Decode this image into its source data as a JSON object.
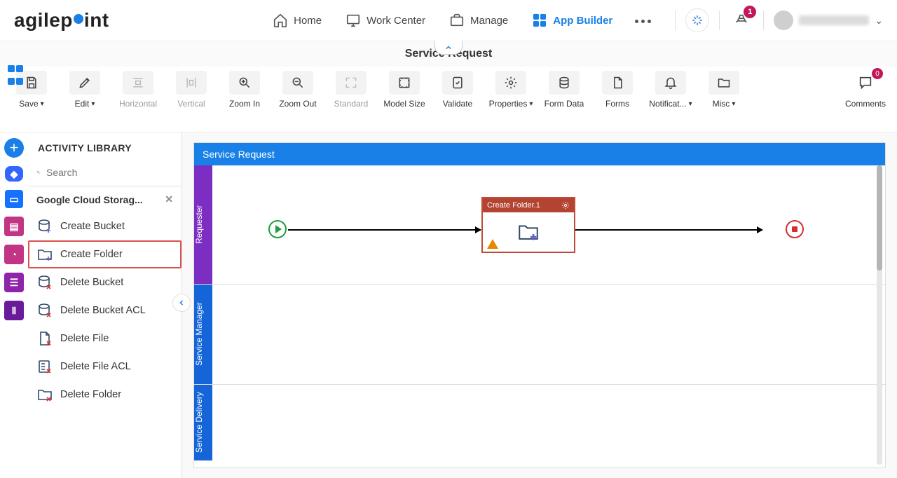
{
  "brand": {
    "text_before": "agilep",
    "text_after": "int"
  },
  "nav": {
    "items": [
      {
        "label": "Home"
      },
      {
        "label": "Work Center"
      },
      {
        "label": "Manage"
      },
      {
        "label": "App Builder"
      }
    ],
    "bell_badge": "1"
  },
  "workspace": {
    "title": "Service Request"
  },
  "toolbar": {
    "save": "Save",
    "edit": "Edit",
    "horizontal": "Horizontal",
    "vertical": "Vertical",
    "zoom_in": "Zoom In",
    "zoom_out": "Zoom Out",
    "standard": "Standard",
    "model_size": "Model Size",
    "validate": "Validate",
    "properties": "Properties",
    "form_data": "Form Data",
    "forms": "Forms",
    "notifications": "Notificat...",
    "misc": "Misc",
    "comments": "Comments",
    "comments_badge": "0"
  },
  "sidebar": {
    "title": "ACTIVITY LIBRARY",
    "search_placeholder": "Search",
    "category": "Google Cloud Storag...",
    "items": [
      {
        "label": "Create Bucket"
      },
      {
        "label": "Create Folder"
      },
      {
        "label": "Delete Bucket"
      },
      {
        "label": "Delete Bucket ACL"
      },
      {
        "label": "Delete File"
      },
      {
        "label": "Delete File ACL"
      },
      {
        "label": "Delete Folder"
      }
    ]
  },
  "canvas": {
    "title": "Service Request",
    "lanes": [
      {
        "label": "Requester"
      },
      {
        "label": "Service Manager"
      },
      {
        "label": "Service Delivery"
      }
    ],
    "activity": {
      "title": "Create Folder.1"
    }
  }
}
